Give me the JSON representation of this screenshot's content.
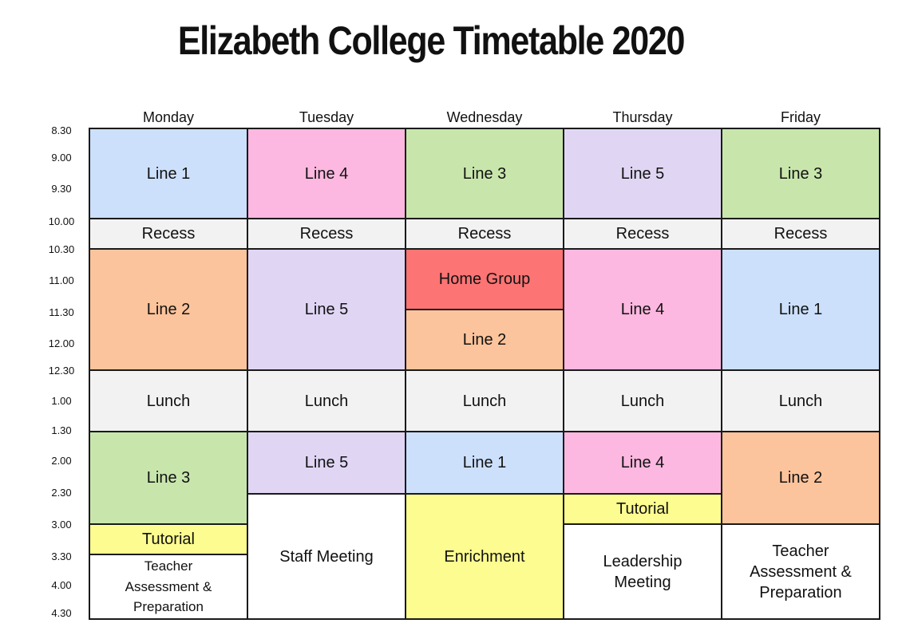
{
  "title": "Elizabeth College Timetable 2020",
  "days": [
    "Monday",
    "Tuesday",
    "Wednesday",
    "Thursday",
    "Friday"
  ],
  "times": [
    "8.30",
    "9.00",
    "9.30",
    "10.00",
    "10.30",
    "11.00",
    "11.30",
    "12.00",
    "12.30",
    "1.00",
    "1.30",
    "2.00",
    "2.30",
    "3.00",
    "3.30",
    "4.00",
    "4.30"
  ],
  "colors": {
    "blue": "#cce0fc",
    "pink": "#fcb8e0",
    "green": "#c8e6ac",
    "lavender": "#e0d6f4",
    "gray": "#f2f2f2",
    "orange": "#fcc49c",
    "red": "#fc7474",
    "yellow": "#fcfc90",
    "white": "#ffffff"
  },
  "schedule": [
    [
      {
        "label": "Line 1",
        "color": "blue",
        "span": 3
      },
      {
        "label": "Recess",
        "color": "gray",
        "span": 1
      },
      {
        "label": "Line 2",
        "color": "orange",
        "span": 4
      },
      {
        "label": "Lunch",
        "color": "gray",
        "span": 2
      },
      {
        "label": "Line 3",
        "color": "green",
        "span": 3
      },
      {
        "label": "Tutorial",
        "color": "yellow",
        "span": 1
      },
      {
        "label": "Teacher\nAssessment &\nPreparation",
        "color": "white",
        "span": 2,
        "small": true
      }
    ],
    [
      {
        "label": "Line 4",
        "color": "pink",
        "span": 3
      },
      {
        "label": "Recess",
        "color": "gray",
        "span": 1
      },
      {
        "label": "Line 5",
        "color": "lavender",
        "span": 4
      },
      {
        "label": "Lunch",
        "color": "gray",
        "span": 2
      },
      {
        "label": "Line 5",
        "color": "lavender",
        "span": 2
      },
      {
        "label": "Staff Meeting",
        "color": "white",
        "span": 4
      }
    ],
    [
      {
        "label": "Line 3",
        "color": "green",
        "span": 3
      },
      {
        "label": "Recess",
        "color": "gray",
        "span": 1
      },
      {
        "label": "Home Group",
        "color": "red",
        "span": 2
      },
      {
        "label": "Line 2",
        "color": "orange",
        "span": 2
      },
      {
        "label": "Lunch",
        "color": "gray",
        "span": 2
      },
      {
        "label": "Line 1",
        "color": "blue",
        "span": 2
      },
      {
        "label": "Enrichment",
        "color": "yellow",
        "span": 4
      }
    ],
    [
      {
        "label": "Line 5",
        "color": "lavender",
        "span": 3
      },
      {
        "label": "Recess",
        "color": "gray",
        "span": 1
      },
      {
        "label": "Line 4",
        "color": "pink",
        "span": 4
      },
      {
        "label": "Lunch",
        "color": "gray",
        "span": 2
      },
      {
        "label": "Line 4",
        "color": "pink",
        "span": 2
      },
      {
        "label": "Tutorial",
        "color": "yellow",
        "span": 1
      },
      {
        "label": "Leadership\nMeeting",
        "color": "white",
        "span": 3
      }
    ],
    [
      {
        "label": "Line 3",
        "color": "green",
        "span": 3
      },
      {
        "label": "Recess",
        "color": "gray",
        "span": 1
      },
      {
        "label": "Line 1",
        "color": "blue",
        "span": 4
      },
      {
        "label": "Lunch",
        "color": "gray",
        "span": 2
      },
      {
        "label": "Line 2",
        "color": "orange",
        "span": 3
      },
      {
        "label": "Teacher\nAssessment &\nPreparation",
        "color": "white",
        "span": 3
      }
    ]
  ]
}
